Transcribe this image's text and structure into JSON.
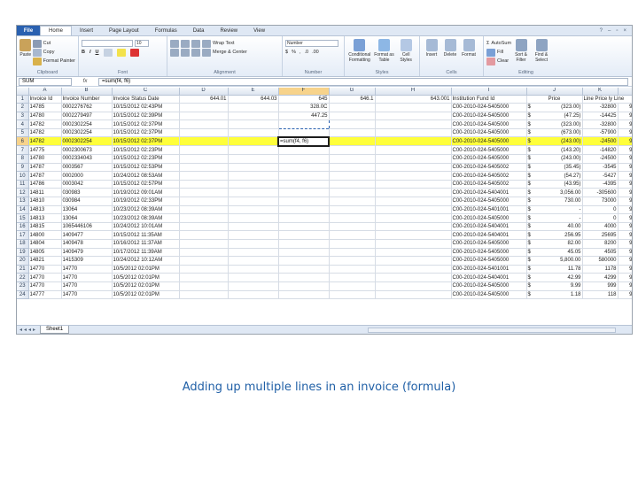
{
  "ribbon": {
    "file_tab": "File",
    "tabs": [
      "Home",
      "Insert",
      "Page Layout",
      "Formulas",
      "Data",
      "Review",
      "View"
    ],
    "clipboard": {
      "paste": "Paste",
      "cut": "Cut",
      "copy": "Copy",
      "format_painter": "Format Painter",
      "group": "Clipboard"
    },
    "font": {
      "size": "10",
      "group": "Font"
    },
    "alignment": {
      "wrap": "Wrap Text",
      "merge": "Merge & Center",
      "group": "Alignment"
    },
    "number": {
      "format": "Number",
      "group": "Number"
    },
    "styles": {
      "conditional": "Conditional Formatting",
      "format_table": "Format as Table",
      "cell_styles": "Cell Styles",
      "group": "Styles"
    },
    "cells": {
      "insert": "Insert",
      "delete": "Delete",
      "format": "Format",
      "group": "Cells"
    },
    "editing": {
      "autosum": "AutoSum",
      "fill": "Fill",
      "clear": "Clear",
      "sort": "Sort & Filter",
      "find": "Find & Select",
      "group": "Editing"
    }
  },
  "formula_bar": {
    "name_box": "SUM",
    "fx": "fx",
    "formula": "=sum(f4, f6)"
  },
  "columns": [
    "A",
    "B",
    "C",
    "D",
    "E",
    "F",
    "G",
    "H",
    "I",
    "J",
    "K"
  ],
  "header_row": [
    "Invoice Id",
    "Invoice Number",
    "Invoice Status Date",
    "644.01",
    "644.03",
    "645",
    "646.1",
    "643.001",
    "Institution Fund Id",
    "Price",
    "Line Price ly Line"
  ],
  "rows": [
    {
      "n": "2",
      "a": "14785",
      "b": "0002276762",
      "c": "10/15/2012 02:43PM",
      "d": "",
      "e": "",
      "f": "328.0C",
      "g": "",
      "h": "",
      "i": "C00-2010-024-5405000",
      "j": "(323.00)",
      "k": "-32800",
      "l": "9"
    },
    {
      "n": "3",
      "a": "14780",
      "b": "0002279497",
      "c": "10/15/2012 02:39PM",
      "d": "",
      "e": "",
      "f": "447.25",
      "g": "",
      "h": "",
      "i": "C00-2010-024-5405000",
      "j": "(47.25)",
      "k": "-14425",
      "l": "9"
    },
    {
      "n": "4",
      "a": "14782",
      "b": "0002302254",
      "c": "10/15/2012 02:37PM",
      "d": "",
      "e": "",
      "f": "",
      "g": "",
      "h": "",
      "i": "C00-2010-024-5405000",
      "j": "(323.00)",
      "k": "-32800",
      "l": "9"
    },
    {
      "n": "5",
      "a": "14782",
      "b": "0002302254",
      "c": "10/15/2012 02:37PM",
      "d": "",
      "e": "",
      "f": "",
      "g": "",
      "h": "",
      "i": "C00-2010-024-5405000",
      "j": "(673.00)",
      "k": "-57900",
      "l": "9"
    },
    {
      "n": "6",
      "a": "14782",
      "b": "0002302254",
      "c": "10/15/2012 02:37PM",
      "d": "",
      "e": "",
      "f": "=sum(f4, f6)",
      "g": "",
      "h": "",
      "i": "C00-2010-024-5405000",
      "j": "(243.00)",
      "k": "-24500",
      "l": "9"
    },
    {
      "n": "7",
      "a": "14775",
      "b": "0002300673",
      "c": "10/15/2012 02:23PM",
      "d": "",
      "e": "",
      "f": "",
      "g": "",
      "h": "",
      "i": "C00-2010-024-5405000",
      "j": "(143.20)",
      "k": "-14820",
      "l": "9"
    },
    {
      "n": "8",
      "a": "14780",
      "b": "0002334043",
      "c": "10/15/2012 02:23PM",
      "d": "",
      "e": "",
      "f": "",
      "g": "",
      "h": "",
      "i": "C00-2010-024-5405000",
      "j": "(243.00)",
      "k": "-24500",
      "l": "9"
    },
    {
      "n": "9",
      "a": "14787",
      "b": "0003567",
      "c": "10/15/2012 02:53PM",
      "d": "",
      "e": "",
      "f": "",
      "g": "",
      "h": "",
      "i": "C00-2010-024-5405002",
      "j": "(35.45)",
      "k": "-3545",
      "l": "9"
    },
    {
      "n": "10",
      "a": "14787",
      "b": "0002000",
      "c": "10/24/2012 08:53AM",
      "d": "",
      "e": "",
      "f": "",
      "g": "",
      "h": "",
      "i": "C00-2010-024-5405002",
      "j": "(54.27)",
      "k": "-5427",
      "l": "9"
    },
    {
      "n": "11",
      "a": "14786",
      "b": "0003042",
      "c": "10/15/2012 02:57PM",
      "d": "",
      "e": "",
      "f": "",
      "g": "",
      "h": "",
      "i": "C00-2010-024-5405002",
      "j": "(43.95)",
      "k": "-4395",
      "l": "9"
    },
    {
      "n": "12",
      "a": "14811",
      "b": "030983",
      "c": "10/19/2012 09:01AM",
      "d": "",
      "e": "",
      "f": "",
      "g": "",
      "h": "",
      "i": "C00-2010-024-5404001",
      "j": "3,056.00",
      "k": "-305600",
      "l": "9"
    },
    {
      "n": "13",
      "a": "14810",
      "b": "030984",
      "c": "10/19/2012 02:33PM",
      "d": "",
      "e": "",
      "f": "",
      "g": "",
      "h": "",
      "i": "C00-2010-024-5405000",
      "j": "730.00",
      "k": "73000",
      "l": "9"
    },
    {
      "n": "14",
      "a": "14813",
      "b": "13064",
      "c": "10/23/2012 08:39AM",
      "d": "",
      "e": "",
      "f": "",
      "g": "",
      "h": "",
      "i": "C00-2010-024-5401001",
      "j": "-",
      "k": "0",
      "l": "9"
    },
    {
      "n": "15",
      "a": "14813",
      "b": "13064",
      "c": "10/23/2012 08:39AM",
      "d": "",
      "e": "",
      "f": "",
      "g": "",
      "h": "",
      "i": "C00-2010-024-5405000",
      "j": "-",
      "k": "0",
      "l": "9"
    },
    {
      "n": "16",
      "a": "14815",
      "b": "1065446106",
      "c": "10/24/2012 10:01AM",
      "d": "",
      "e": "",
      "f": "",
      "g": "",
      "h": "",
      "i": "C00-2010-024-5404001",
      "j": "40.00",
      "k": "4000",
      "l": "9"
    },
    {
      "n": "17",
      "a": "14800",
      "b": "1409477",
      "c": "10/15/2012 11:35AM",
      "d": "",
      "e": "",
      "f": "",
      "g": "",
      "h": "",
      "i": "C00-2010-024-5404001",
      "j": "256.95",
      "k": "25695",
      "l": "9"
    },
    {
      "n": "18",
      "a": "14804",
      "b": "1409478",
      "c": "10/16/2012 11:37AM",
      "d": "",
      "e": "",
      "f": "",
      "g": "",
      "h": "",
      "i": "C00-2010-024-5405000",
      "j": "82.00",
      "k": "8200",
      "l": "9"
    },
    {
      "n": "19",
      "a": "14805",
      "b": "1409479",
      "c": "10/17/2012 11:39AM",
      "d": "",
      "e": "",
      "f": "",
      "g": "",
      "h": "",
      "i": "C00-2010-024-5405000",
      "j": "45.05",
      "k": "4505",
      "l": "9"
    },
    {
      "n": "20",
      "a": "14821",
      "b": "1415309",
      "c": "10/24/2012 10:12AM",
      "d": "",
      "e": "",
      "f": "",
      "g": "",
      "h": "",
      "i": "C00-2010-024-5405000",
      "j": "5,800.00",
      "k": "580000",
      "l": "9"
    },
    {
      "n": "21",
      "a": "14770",
      "b": "14770",
      "c": "10/5/2012 02:01PM",
      "d": "",
      "e": "",
      "f": "",
      "g": "",
      "h": "",
      "i": "C00-2010-024-5401001",
      "j": "11.78",
      "k": "1178",
      "l": "9"
    },
    {
      "n": "22",
      "a": "14770",
      "b": "14770",
      "c": "10/5/2012 02:01PM",
      "d": "",
      "e": "",
      "f": "",
      "g": "",
      "h": "",
      "i": "C00-2010-024-5404001",
      "j": "42.99",
      "k": "4299",
      "l": "9"
    },
    {
      "n": "23",
      "a": "14770",
      "b": "14770",
      "c": "10/5/2012 02:01PM",
      "d": "",
      "e": "",
      "f": "",
      "g": "",
      "h": "",
      "i": "C00-2010-024-5405000",
      "j": "9.99",
      "k": "999",
      "l": "9"
    },
    {
      "n": "24",
      "a": "14777",
      "b": "14770",
      "c": "10/5/2012 02:01PM",
      "d": "",
      "e": "",
      "f": "",
      "g": "",
      "h": "",
      "i": "C00-2010-024-5405000",
      "j": "1.18",
      "k": "118",
      "l": "9"
    }
  ],
  "currency_symbol": "$",
  "sheet_tab": "Sheet1",
  "caption": "Adding up multiple lines in an invoice (formula)",
  "colors": {
    "highlight": "#ffff3a",
    "accent": "#2a61b0",
    "caption": "#1f5fa6"
  }
}
